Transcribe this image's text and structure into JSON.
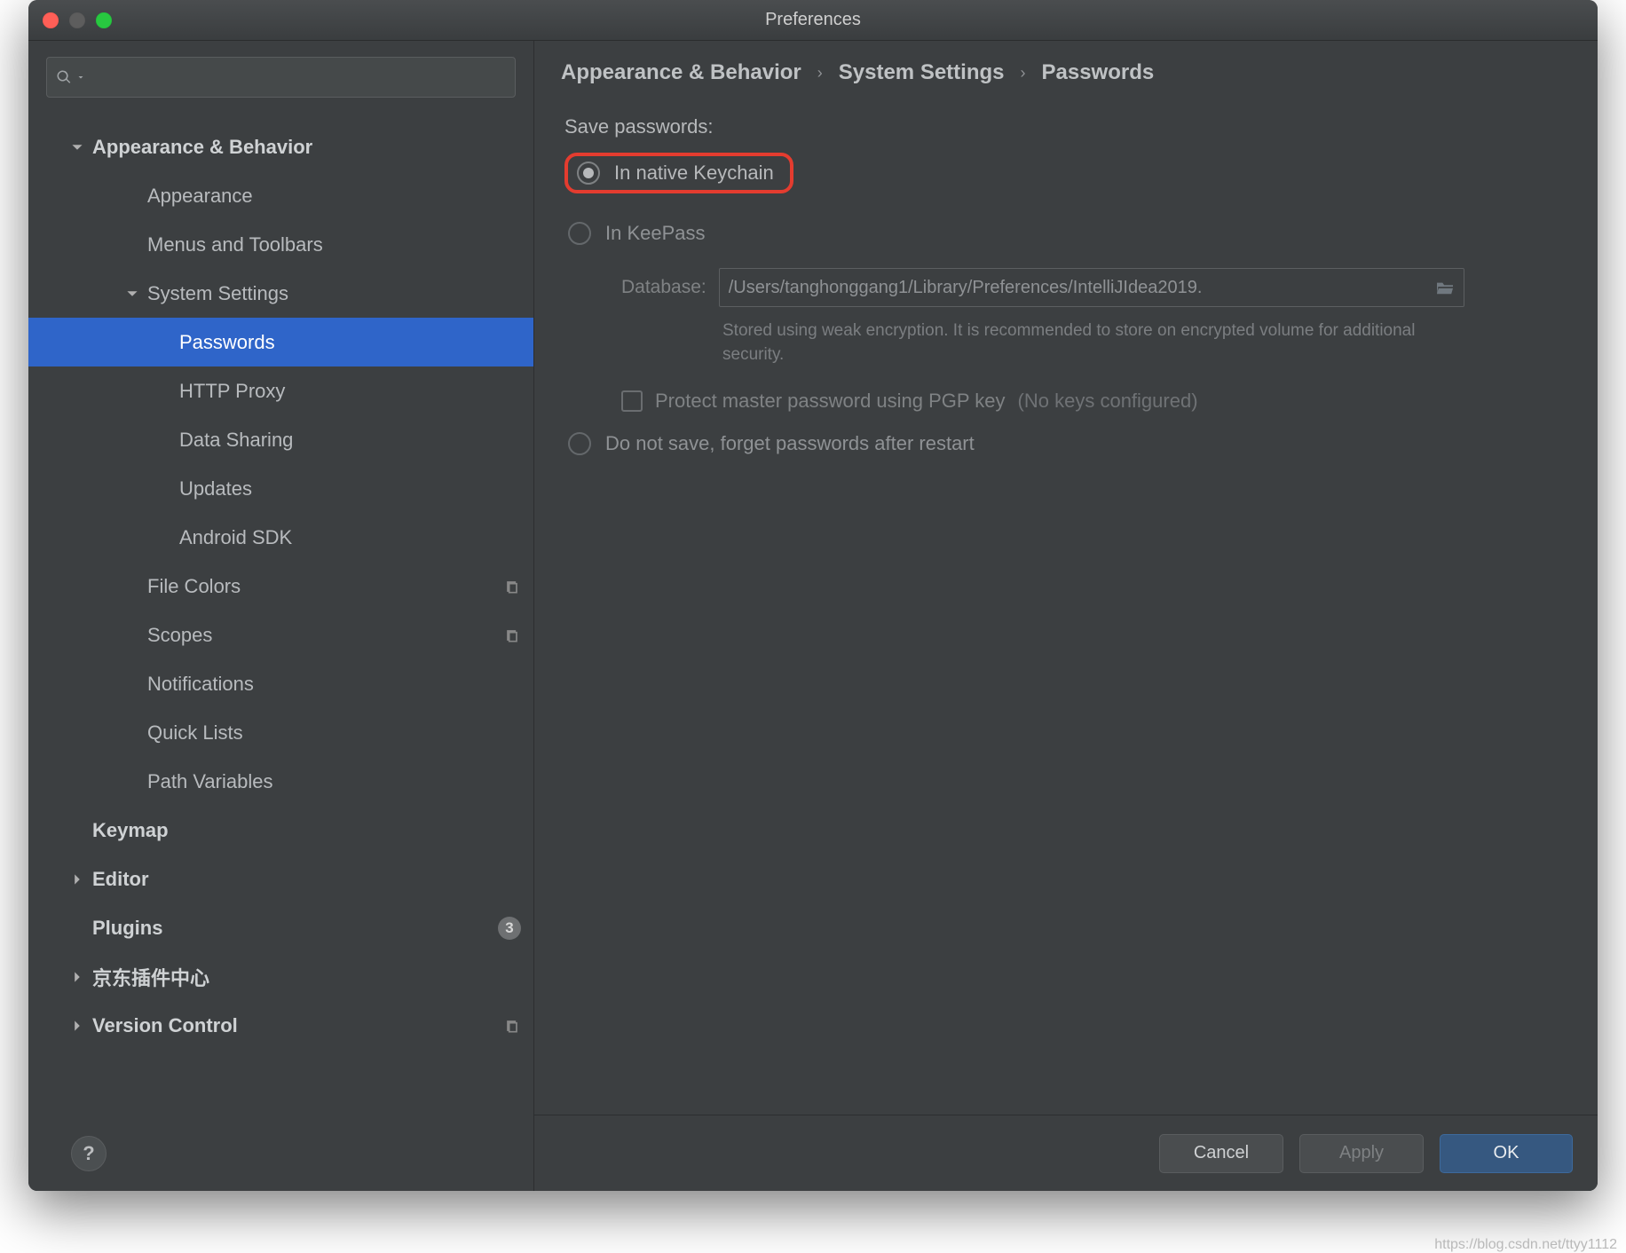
{
  "window": {
    "title": "Preferences"
  },
  "search": {
    "placeholder": ""
  },
  "sidebar": {
    "items": [
      {
        "label": "Appearance & Behavior",
        "bold": true,
        "arrow": "down",
        "level": 0
      },
      {
        "label": "Appearance",
        "bold": false,
        "arrow": "none",
        "level": 1
      },
      {
        "label": "Menus and Toolbars",
        "bold": false,
        "arrow": "none",
        "level": 1
      },
      {
        "label": "System Settings",
        "bold": false,
        "arrow": "down",
        "level": 1
      },
      {
        "label": "Passwords",
        "bold": false,
        "arrow": "none",
        "level": 2,
        "selected": true
      },
      {
        "label": "HTTP Proxy",
        "bold": false,
        "arrow": "none",
        "level": 2
      },
      {
        "label": "Data Sharing",
        "bold": false,
        "arrow": "none",
        "level": 2
      },
      {
        "label": "Updates",
        "bold": false,
        "arrow": "none",
        "level": 2
      },
      {
        "label": "Android SDK",
        "bold": false,
        "arrow": "none",
        "level": 2
      },
      {
        "label": "File Colors",
        "bold": false,
        "arrow": "none",
        "level": 1,
        "copy": true
      },
      {
        "label": "Scopes",
        "bold": false,
        "arrow": "none",
        "level": 1,
        "copy": true
      },
      {
        "label": "Notifications",
        "bold": false,
        "arrow": "none",
        "level": 1
      },
      {
        "label": "Quick Lists",
        "bold": false,
        "arrow": "none",
        "level": 1
      },
      {
        "label": "Path Variables",
        "bold": false,
        "arrow": "none",
        "level": 1
      },
      {
        "label": "Keymap",
        "bold": true,
        "arrow": "none",
        "level": 0
      },
      {
        "label": "Editor",
        "bold": true,
        "arrow": "right",
        "level": 0
      },
      {
        "label": "Plugins",
        "bold": true,
        "arrow": "none",
        "level": 0,
        "count": "3"
      },
      {
        "label": "京东插件中心",
        "bold": true,
        "arrow": "right",
        "level": 0
      },
      {
        "label": "Version Control",
        "bold": true,
        "arrow": "right",
        "level": 0,
        "copy": true
      }
    ]
  },
  "breadcrumb": {
    "a": "Appearance & Behavior",
    "b": "System Settings",
    "c": "Passwords"
  },
  "form": {
    "section_label": "Save passwords:",
    "opt1": "In native Keychain",
    "opt2": "In KeePass",
    "db_label": "Database:",
    "db_value": "/Users/tanghonggang1/Library/Preferences/IntelliJIdea2019.",
    "hint": "Stored using weak encryption. It is recommended to store on encrypted volume for additional security.",
    "protect_label": "Protect master password using PGP key",
    "protect_note": "(No keys configured)",
    "opt3": "Do not save, forget passwords after restart"
  },
  "footer": {
    "cancel": "Cancel",
    "apply": "Apply",
    "ok": "OK"
  },
  "help_label": "?",
  "watermark": "https://blog.csdn.net/ttyy1112"
}
